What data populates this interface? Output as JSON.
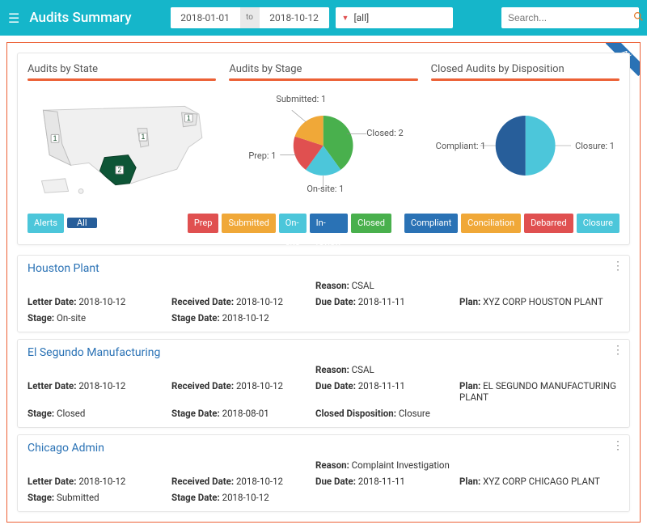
{
  "header": {
    "title": "Audits Summary",
    "date_from": "2018-01-01",
    "date_to_label": "to",
    "date_to": "2018-10-12",
    "filter_value": "[all]",
    "search_placeholder": "Search..."
  },
  "corner_ribbon": "All",
  "panels": {
    "by_state": {
      "title": "Audits by State"
    },
    "by_stage": {
      "title": "Audits by Stage"
    },
    "by_disposition": {
      "title": "Closed Audits by Disposition"
    }
  },
  "chart_data": [
    {
      "type": "map",
      "title": "Audits by State",
      "series": [
        {
          "state": "CA",
          "value": 1
        },
        {
          "state": "TX",
          "value": 2
        },
        {
          "state": "IL",
          "value": 1
        },
        {
          "state": "NY",
          "value": 1
        }
      ]
    },
    {
      "type": "pie",
      "title": "Audits by Stage",
      "series": [
        {
          "name": "Submitted",
          "value": 1,
          "color": "#f0a838"
        },
        {
          "name": "Prep",
          "value": 1,
          "color": "#e05050"
        },
        {
          "name": "On-site",
          "value": 1,
          "color": "#4cc6da"
        },
        {
          "name": "Closed",
          "value": 2,
          "color": "#49b04d"
        }
      ]
    },
    {
      "type": "pie",
      "title": "Closed Audits by Disposition",
      "series": [
        {
          "name": "Compliant",
          "value": 1,
          "color": "#275e9a"
        },
        {
          "name": "Closure",
          "value": 1,
          "color": "#4cc6da"
        }
      ]
    }
  ],
  "pie_labels": {
    "stage": {
      "submitted": "Submitted: 1",
      "prep": "Prep: 1",
      "onsite": "On-site: 1",
      "closed": "Closed: 2"
    },
    "disposition": {
      "compliant": "Compliant: 1",
      "closure": "Closure: 1"
    }
  },
  "map_counts": {
    "ca": "1",
    "tx": "2",
    "il": "1",
    "ny": "1"
  },
  "buttons": {
    "alerts": "Alerts",
    "all": "All",
    "prep": "Prep",
    "submitted": "Submitted",
    "onsite": "On-site",
    "inreview": "In-review",
    "closed": "Closed",
    "compliant": "Compliant",
    "conciliation": "Conciliation",
    "debarred": "Debarred",
    "closure": "Closure"
  },
  "labels": {
    "letter_date": "Letter Date:",
    "received_date": "Received Date:",
    "reason": "Reason:",
    "plan": "Plan:",
    "stage": "Stage:",
    "stage_date": "Stage Date:",
    "due_date": "Due Date:",
    "closed_disposition": "Closed Disposition:"
  },
  "audits": [
    {
      "title": "Houston Plant",
      "letter_date": "2018-10-12",
      "received_date": "2018-10-12",
      "reason": "CSAL",
      "plan": "XYZ CORP HOUSTON PLANT",
      "stage": "On-site",
      "stage_date": "2018-10-12",
      "due_date": "2018-11-11",
      "closed_disposition": ""
    },
    {
      "title": "El Segundo Manufacturing",
      "letter_date": "2018-10-12",
      "received_date": "2018-10-12",
      "reason": "CSAL",
      "plan": "EL SEGUNDO MANUFACTURING PLANT",
      "stage": "Closed",
      "stage_date": "2018-08-01",
      "due_date": "2018-11-11",
      "closed_disposition": "Closure"
    },
    {
      "title": "Chicago Admin",
      "letter_date": "2018-10-12",
      "received_date": "2018-10-12",
      "reason": "Complaint Investigation",
      "plan": "XYZ CORP CHICAGO PLANT",
      "stage": "Submitted",
      "stage_date": "2018-10-12",
      "due_date": "2018-11-11",
      "closed_disposition": ""
    }
  ]
}
